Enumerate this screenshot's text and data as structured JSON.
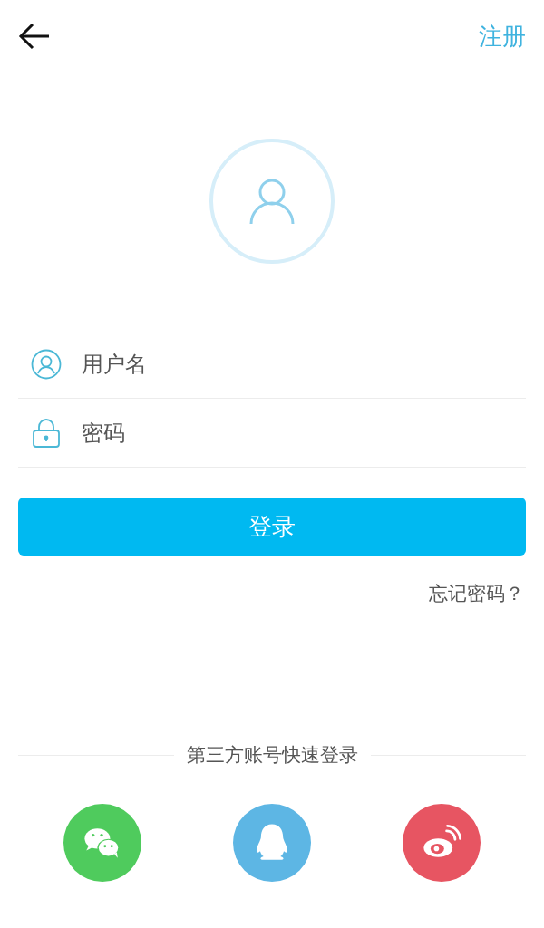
{
  "header": {
    "register_link": "注册"
  },
  "fields": [
    {
      "kind": "user",
      "placeholder": "用户名"
    },
    {
      "kind": "lock",
      "placeholder": "密码"
    }
  ],
  "login_button": "登录",
  "forgot_link": "忘记密码？",
  "third_party": {
    "title": "第三方账号快速登录",
    "buttons": [
      {
        "kind": "wechat",
        "color": "#4fcb5d"
      },
      {
        "kind": "qq",
        "color": "#5db6e4"
      },
      {
        "kind": "weibo",
        "color": "#e75562"
      }
    ]
  }
}
